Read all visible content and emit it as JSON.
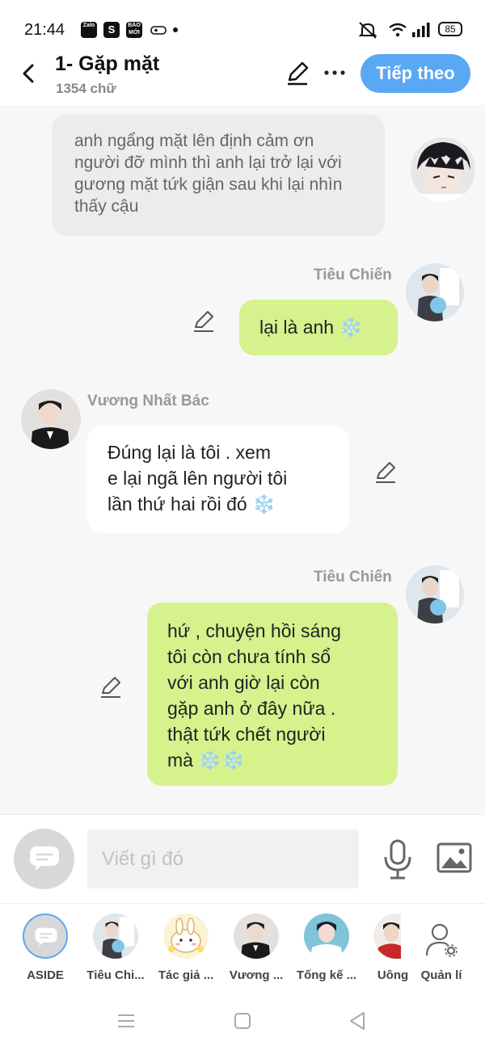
{
  "status_bar": {
    "time": "21:44",
    "apps": [
      "Zalo",
      "S",
      "BÁO MỚI"
    ],
    "battery": "85"
  },
  "header": {
    "title": "1- Gặp mặt",
    "word_count": "1354 chữ",
    "next_label": "Tiếp theo",
    "accent_color": "#59a8f4"
  },
  "messages": {
    "narration": "anh ngẩng mặt lên định  cảm ơn người đỡ mình thì anh lại trở lại với gương mặt tứk giận sau khi lại nhìn thấy cậu",
    "m1": {
      "speaker": "Tiêu Chiến",
      "text": "lại là anh ❄️"
    },
    "m2": {
      "speaker": "Vương Nhất Bác",
      "lines": [
        "Đúng lại là tôi . xem",
        "e lại ngã lên người tôi",
        "lần thứ hai rồi đó ❄️"
      ]
    },
    "m3": {
      "speaker": "Tiêu Chiến",
      "lines": [
        "hứ  , chuyện hồi sáng",
        "tôi còn chưa tính sổ",
        "với anh giờ lại còn",
        "gặp anh ở đây nữa .",
        "thật tứk chết người",
        "mà ❄️❄️"
      ]
    },
    "bubble_green_color": "#d5f28d"
  },
  "input": {
    "placeholder": "Viết gì đó"
  },
  "characters": [
    {
      "label": "ASIDE"
    },
    {
      "label": "Tiêu Chi..."
    },
    {
      "label": "Tác giả ..."
    },
    {
      "label": "Vương ..."
    },
    {
      "label": "Tống kế ..."
    },
    {
      "label": "Uông"
    },
    {
      "label": "Quản lí"
    }
  ]
}
